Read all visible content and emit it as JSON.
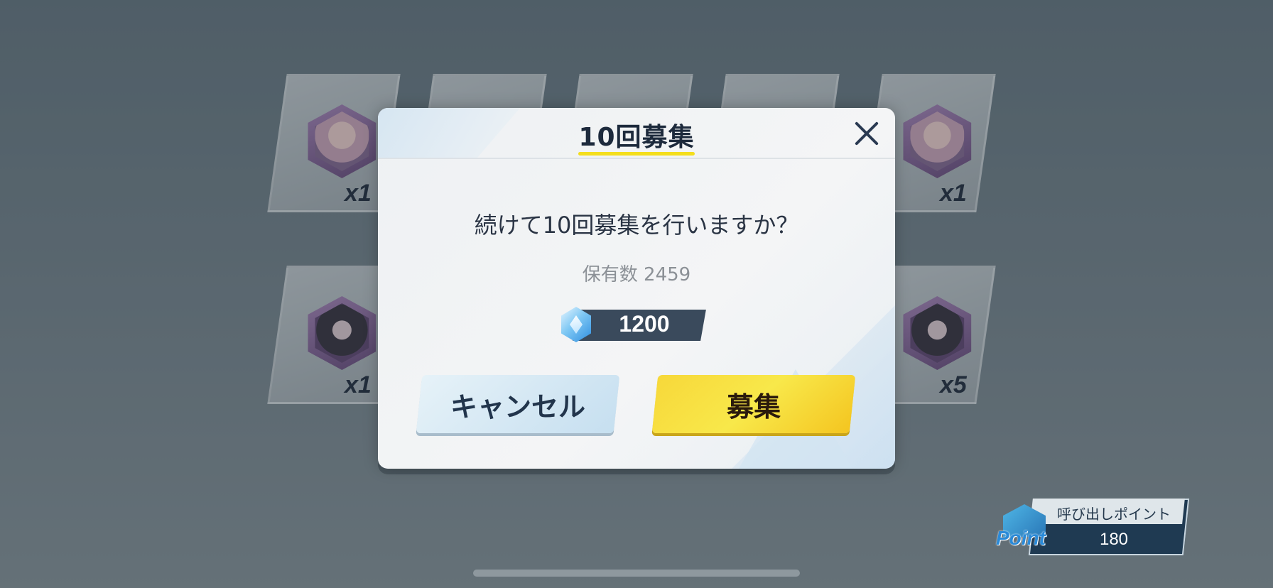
{
  "dialog": {
    "title": "10回募集",
    "question": "続けて10回募集を行いますか？",
    "owned": "保有数 2459",
    "cost": "1200",
    "cancel_label": "キャンセル",
    "confirm_label": "募集"
  },
  "cards": [
    {
      "count": "x1"
    },
    {
      "count": "x1"
    },
    {
      "count": "x1"
    },
    {
      "count": "x5"
    }
  ],
  "point_badge": {
    "label": "呼び出しポイント",
    "value": "180",
    "icon_word": "Point"
  },
  "colors": {
    "accent_yellow": "#f7d83a",
    "title_underline": "#f4de1c",
    "dark_navy": "#1d2a3c"
  },
  "icons": {
    "close": "close-icon",
    "gem": "crystal-gem-icon",
    "point": "point-envelope-icon"
  }
}
